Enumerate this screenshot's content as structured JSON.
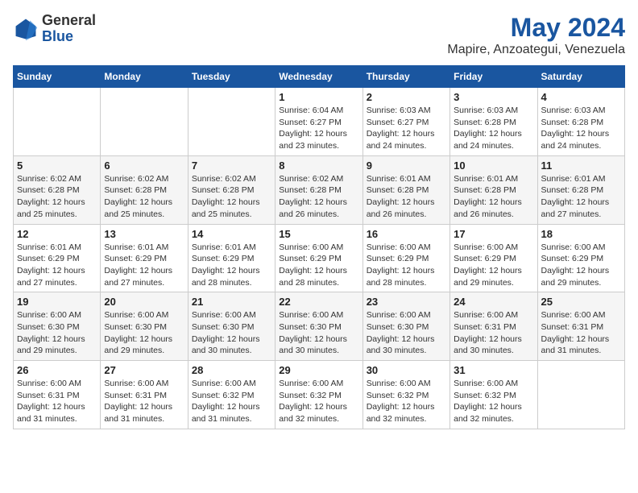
{
  "logo": {
    "line1": "General",
    "line2": "Blue"
  },
  "title": "May 2024",
  "subtitle": "Mapire, Anzoategui, Venezuela",
  "days_of_week": [
    "Sunday",
    "Monday",
    "Tuesday",
    "Wednesday",
    "Thursday",
    "Friday",
    "Saturday"
  ],
  "weeks": [
    [
      {
        "num": "",
        "info": ""
      },
      {
        "num": "",
        "info": ""
      },
      {
        "num": "",
        "info": ""
      },
      {
        "num": "1",
        "info": "Sunrise: 6:04 AM\nSunset: 6:27 PM\nDaylight: 12 hours and 23 minutes."
      },
      {
        "num": "2",
        "info": "Sunrise: 6:03 AM\nSunset: 6:27 PM\nDaylight: 12 hours and 24 minutes."
      },
      {
        "num": "3",
        "info": "Sunrise: 6:03 AM\nSunset: 6:28 PM\nDaylight: 12 hours and 24 minutes."
      },
      {
        "num": "4",
        "info": "Sunrise: 6:03 AM\nSunset: 6:28 PM\nDaylight: 12 hours and 24 minutes."
      }
    ],
    [
      {
        "num": "5",
        "info": "Sunrise: 6:02 AM\nSunset: 6:28 PM\nDaylight: 12 hours and 25 minutes."
      },
      {
        "num": "6",
        "info": "Sunrise: 6:02 AM\nSunset: 6:28 PM\nDaylight: 12 hours and 25 minutes."
      },
      {
        "num": "7",
        "info": "Sunrise: 6:02 AM\nSunset: 6:28 PM\nDaylight: 12 hours and 25 minutes."
      },
      {
        "num": "8",
        "info": "Sunrise: 6:02 AM\nSunset: 6:28 PM\nDaylight: 12 hours and 26 minutes."
      },
      {
        "num": "9",
        "info": "Sunrise: 6:01 AM\nSunset: 6:28 PM\nDaylight: 12 hours and 26 minutes."
      },
      {
        "num": "10",
        "info": "Sunrise: 6:01 AM\nSunset: 6:28 PM\nDaylight: 12 hours and 26 minutes."
      },
      {
        "num": "11",
        "info": "Sunrise: 6:01 AM\nSunset: 6:28 PM\nDaylight: 12 hours and 27 minutes."
      }
    ],
    [
      {
        "num": "12",
        "info": "Sunrise: 6:01 AM\nSunset: 6:29 PM\nDaylight: 12 hours and 27 minutes."
      },
      {
        "num": "13",
        "info": "Sunrise: 6:01 AM\nSunset: 6:29 PM\nDaylight: 12 hours and 27 minutes."
      },
      {
        "num": "14",
        "info": "Sunrise: 6:01 AM\nSunset: 6:29 PM\nDaylight: 12 hours and 28 minutes."
      },
      {
        "num": "15",
        "info": "Sunrise: 6:00 AM\nSunset: 6:29 PM\nDaylight: 12 hours and 28 minutes."
      },
      {
        "num": "16",
        "info": "Sunrise: 6:00 AM\nSunset: 6:29 PM\nDaylight: 12 hours and 28 minutes."
      },
      {
        "num": "17",
        "info": "Sunrise: 6:00 AM\nSunset: 6:29 PM\nDaylight: 12 hours and 29 minutes."
      },
      {
        "num": "18",
        "info": "Sunrise: 6:00 AM\nSunset: 6:29 PM\nDaylight: 12 hours and 29 minutes."
      }
    ],
    [
      {
        "num": "19",
        "info": "Sunrise: 6:00 AM\nSunset: 6:30 PM\nDaylight: 12 hours and 29 minutes."
      },
      {
        "num": "20",
        "info": "Sunrise: 6:00 AM\nSunset: 6:30 PM\nDaylight: 12 hours and 29 minutes."
      },
      {
        "num": "21",
        "info": "Sunrise: 6:00 AM\nSunset: 6:30 PM\nDaylight: 12 hours and 30 minutes."
      },
      {
        "num": "22",
        "info": "Sunrise: 6:00 AM\nSunset: 6:30 PM\nDaylight: 12 hours and 30 minutes."
      },
      {
        "num": "23",
        "info": "Sunrise: 6:00 AM\nSunset: 6:30 PM\nDaylight: 12 hours and 30 minutes."
      },
      {
        "num": "24",
        "info": "Sunrise: 6:00 AM\nSunset: 6:31 PM\nDaylight: 12 hours and 30 minutes."
      },
      {
        "num": "25",
        "info": "Sunrise: 6:00 AM\nSunset: 6:31 PM\nDaylight: 12 hours and 31 minutes."
      }
    ],
    [
      {
        "num": "26",
        "info": "Sunrise: 6:00 AM\nSunset: 6:31 PM\nDaylight: 12 hours and 31 minutes."
      },
      {
        "num": "27",
        "info": "Sunrise: 6:00 AM\nSunset: 6:31 PM\nDaylight: 12 hours and 31 minutes."
      },
      {
        "num": "28",
        "info": "Sunrise: 6:00 AM\nSunset: 6:32 PM\nDaylight: 12 hours and 31 minutes."
      },
      {
        "num": "29",
        "info": "Sunrise: 6:00 AM\nSunset: 6:32 PM\nDaylight: 12 hours and 32 minutes."
      },
      {
        "num": "30",
        "info": "Sunrise: 6:00 AM\nSunset: 6:32 PM\nDaylight: 12 hours and 32 minutes."
      },
      {
        "num": "31",
        "info": "Sunrise: 6:00 AM\nSunset: 6:32 PM\nDaylight: 12 hours and 32 minutes."
      },
      {
        "num": "",
        "info": ""
      }
    ]
  ]
}
